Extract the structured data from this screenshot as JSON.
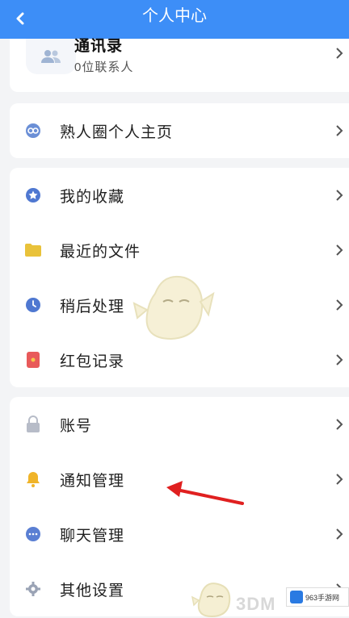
{
  "header": {
    "title": "个人中心"
  },
  "contact": {
    "name": "通讯录",
    "count": "0位联系人"
  },
  "groups": [
    [
      {
        "label": "熟人圈个人主页",
        "icon": "circle-icon"
      }
    ],
    [
      {
        "label": "我的收藏",
        "icon": "star-icon"
      },
      {
        "label": "最近的文件",
        "icon": "folder-icon"
      },
      {
        "label": "稍后处理",
        "icon": "clock-icon"
      },
      {
        "label": "红包记录",
        "icon": "red-envelope-icon"
      }
    ],
    [
      {
        "label": "账号",
        "icon": "lock-icon"
      },
      {
        "label": "通知管理",
        "icon": "bell-icon"
      },
      {
        "label": "聊天管理",
        "icon": "chat-icon"
      },
      {
        "label": "其他设置",
        "icon": "gear-icon"
      }
    ]
  ],
  "watermark": {
    "brand": "3DM",
    "site": "963手游网"
  },
  "colors": {
    "header": "#3d8ef7",
    "arrow": "#e02020"
  }
}
